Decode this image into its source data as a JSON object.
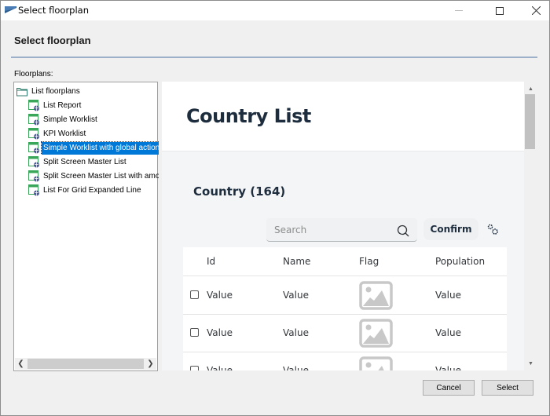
{
  "window": {
    "title": "Select floorplan",
    "controls": [
      "minimize",
      "maximize",
      "close"
    ]
  },
  "header": {
    "title": "Select floorplan"
  },
  "floorplans": {
    "label": "Floorplans:",
    "root": "List floorplans",
    "items": [
      {
        "label": "List Report",
        "selected": false
      },
      {
        "label": "Simple Worklist",
        "selected": false
      },
      {
        "label": "KPI Worklist",
        "selected": false
      },
      {
        "label": "Simple Worklist with global action",
        "selected": true
      },
      {
        "label": "Split Screen Master List",
        "selected": false
      },
      {
        "label": "Split Screen Master List with amou",
        "selected": false
      },
      {
        "label": "List For Grid Expanded Line",
        "selected": false
      }
    ]
  },
  "preview": {
    "page_title": "Country List",
    "table_title": "Country (164)",
    "search_placeholder": "Search",
    "confirm_label": "Confirm",
    "columns": [
      "Id",
      "Name",
      "Flag",
      "Population"
    ],
    "rows": [
      {
        "id": "Value",
        "name": "Value",
        "flag": "image-placeholder",
        "population": "Value"
      },
      {
        "id": "Value",
        "name": "Value",
        "flag": "image-placeholder",
        "population": "Value"
      },
      {
        "id": "Value",
        "name": "Value",
        "flag": "image-placeholder",
        "population": "Value"
      }
    ]
  },
  "footer": {
    "cancel_label": "Cancel",
    "select_label": "Select"
  },
  "colors": {
    "selection": "#0078d7",
    "header_rule": "#9cb0c9",
    "preview_text": "#1d2d3e"
  }
}
